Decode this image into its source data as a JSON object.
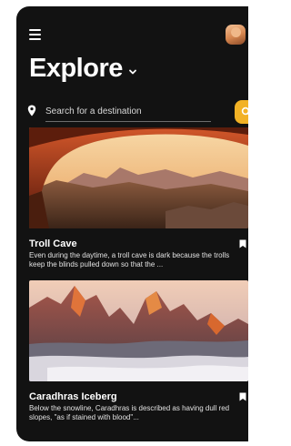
{
  "header": {
    "title": "Explore",
    "menu_icon": "hamburger-menu-icon",
    "title_icon": "chevron-down-icon"
  },
  "search": {
    "placeholder": "Search for a destination",
    "value": "",
    "location_icon": "map-pin-icon",
    "button_icon": "search-icon"
  },
  "colors": {
    "background": "#121212",
    "accent": "#f2b225",
    "text": "#ffffff"
  },
  "cards": [
    {
      "title": "Troll Cave",
      "description": "Even during the daytime, a troll cave is dark because the trolls keep the blinds pulled down so that the ...",
      "bookmark_icon": "bookmark-icon"
    },
    {
      "title": "Caradhras Iceberg",
      "description": "Below the snowline, Caradhras is described as having dull red slopes, \"as if stained with blood\"...",
      "bookmark_icon": "bookmark-icon"
    }
  ]
}
